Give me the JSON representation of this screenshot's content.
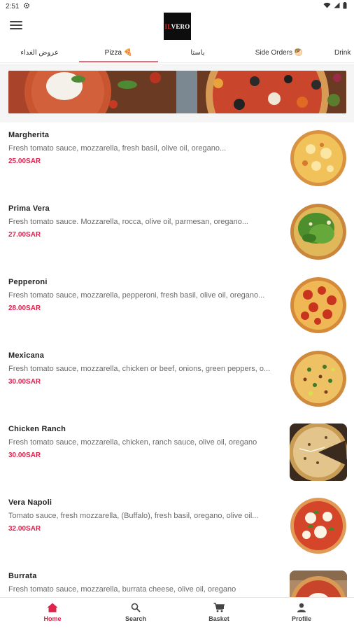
{
  "status_bar": {
    "time": "2:51",
    "settings_icon": "gear-icon",
    "wifi_icon": "wifi-icon",
    "signal_icon": "signal-icon",
    "battery_icon": "battery-icon"
  },
  "header": {
    "menu_icon": "hamburger-menu-icon",
    "logo_text_left": "IL",
    "logo_text_main": "VERO"
  },
  "tabs": [
    {
      "label": "عروض الغداء"
    },
    {
      "label": "Pizza 🍕"
    },
    {
      "label": "باستا"
    },
    {
      "label": "Side Orders 🥙"
    },
    {
      "label": "Drink"
    }
  ],
  "active_tab": "Pizza 🍕",
  "items": [
    {
      "name": "Margherita",
      "description": "Fresh tomato sauce, mozzarella, fresh basil, olive oil, oregano...",
      "price": "25.00SAR"
    },
    {
      "name": "Prima Vera",
      "description": "Fresh tomato sauce. Mozzarella, rocca, olive oil, parmesan, oregano...",
      "price": "27.00SAR"
    },
    {
      "name": "Pepperoni",
      "description": "Fresh tomato sauce, mozzarella, pepperoni, fresh basil, olive oil, oregano...",
      "price": "28.00SAR"
    },
    {
      "name": "Mexicana",
      "description": "Fresh tomato sauce, mozzarella, chicken or beef, onions, green peppers, o...",
      "price": "30.00SAR"
    },
    {
      "name": "Chicken Ranch",
      "description": "Fresh tomato sauce, mozzarella, chicken, ranch sauce, olive oil, oregano",
      "price": "30.00SAR"
    },
    {
      "name": "Vera Napoli",
      "description": "Tomato sauce, fresh mozzarella, (Buffalo), fresh basil, oregano, olive oil...",
      "price": "32.00SAR"
    },
    {
      "name": "Burrata",
      "description": "Fresh tomato sauce, mozzarella, burrata cheese, olive oil, oregano",
      "price": ""
    }
  ],
  "bottom_nav": [
    {
      "label": "Home",
      "icon": "home-icon"
    },
    {
      "label": "Search",
      "icon": "search-icon"
    },
    {
      "label": "Basket",
      "icon": "cart-icon"
    },
    {
      "label": "Profile",
      "icon": "profile-icon"
    }
  ],
  "colors": {
    "accent": "#e0234c",
    "tab_indicator": "#ef6a78",
    "background": "#f5f5f5"
  }
}
